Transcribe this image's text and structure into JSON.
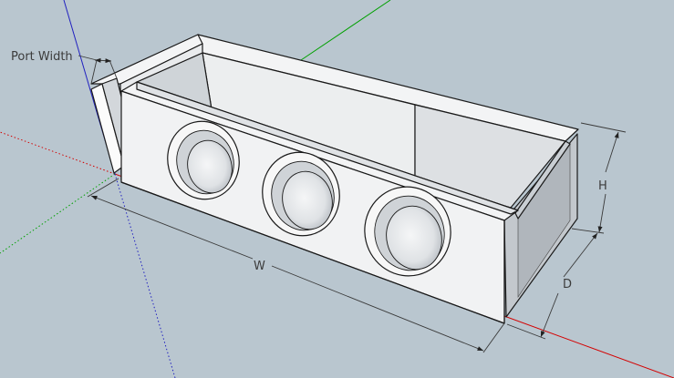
{
  "labels": {
    "port_width": "Port Width",
    "width": "W",
    "height": "H",
    "depth": "D"
  },
  "colors": {
    "background": "#b9c6cf",
    "face_white": "#f2f2f2",
    "face_light": "#e4e6e8",
    "face_shadow": "#c9ced3",
    "face_dark": "#b7bcc2",
    "axis_red": "#d40000",
    "axis_green": "#00a000",
    "axis_blue": "#2020c0"
  },
  "icons": {
    "dimension_arrow": "arrowhead"
  }
}
